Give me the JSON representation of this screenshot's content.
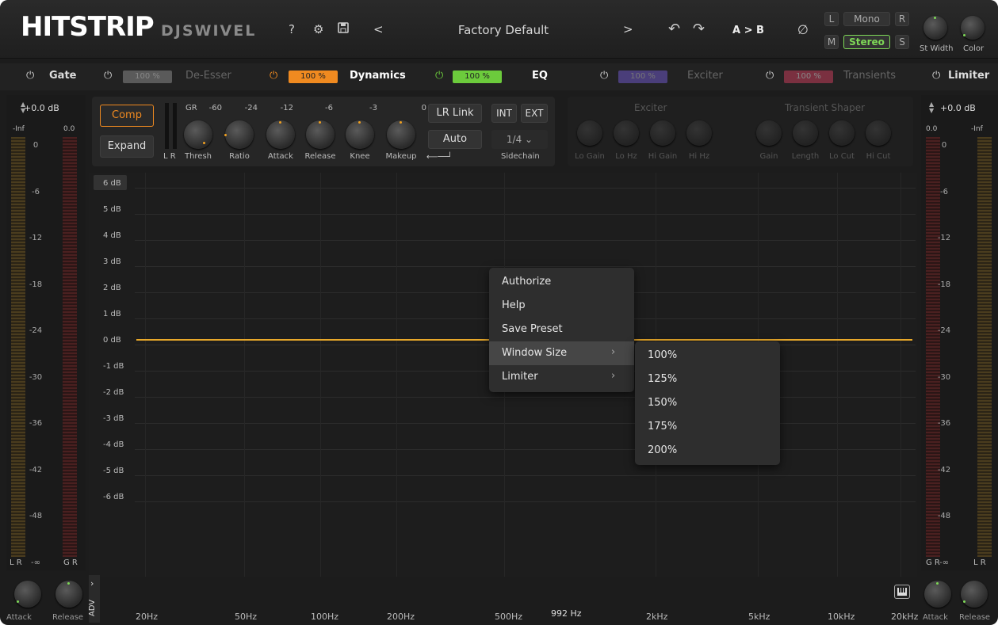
{
  "header": {
    "logo": "HITSTRIP",
    "brand": "DJSWIVEL",
    "help": "?",
    "gear": "⚙",
    "save": "🖫",
    "prev": "<",
    "preset": "Factory Default",
    "next": ">",
    "undo": "↶",
    "redo": "↷",
    "ab": "A > B",
    "bypass": "∅",
    "l": "L",
    "mono": "Mono",
    "r": "R",
    "m": "M",
    "stereo": "Stereo",
    "s": "S",
    "st_width": "St Width",
    "color": "Color"
  },
  "modules": {
    "gate": "Gate",
    "deesser": "De-Esser",
    "deesser_pct": "100 %",
    "dynamics": "Dynamics",
    "dynamics_pct": "100 %",
    "eq": "EQ",
    "eq_pct": "100 %",
    "exciter": "Exciter",
    "exciter_pct": "100 %",
    "transients": "Transients",
    "transients_pct": "100 %",
    "limiter": "Limiter"
  },
  "left_meter": {
    "value": "+0.0 dB",
    "top_left": "-Inf",
    "top_right": "0.0",
    "marks": [
      "0",
      "-6",
      "-12",
      "-18",
      "-24",
      "-30",
      "-36",
      "-42",
      "-48",
      "-∞"
    ],
    "foot_left": "L R",
    "foot_right": "G R",
    "attack": "Attack",
    "release": "Release"
  },
  "right_meter": {
    "value": "+0.0 dB",
    "top_left": "0.0",
    "top_right": "-Inf",
    "marks": [
      "0",
      "-6",
      "-12",
      "-18",
      "-24",
      "-30",
      "-36",
      "-42",
      "-48",
      "-∞"
    ],
    "foot_left": "G R",
    "foot_right": "L R",
    "attack": "Attack",
    "release": "Release"
  },
  "dynamics": {
    "comp": "Comp",
    "expand": "Expand",
    "gr": "GR",
    "gr_scale": [
      "-60",
      "-24",
      "-12",
      "-6",
      "-3",
      "0"
    ],
    "lr": "L R",
    "knobs": [
      "Thresh",
      "Ratio",
      "Attack",
      "Release",
      "Knee",
      "Makeup"
    ],
    "lr_link": "LR Link",
    "int": "INT",
    "ext": "EXT",
    "auto": "Auto",
    "sidechain_val": "1/4",
    "sidechain": "Sidechain"
  },
  "exciter": {
    "title": "Exciter",
    "knobs": [
      "Lo Gain",
      "Lo Hz",
      "Hi Gain",
      "Hi Hz"
    ]
  },
  "transient": {
    "title": "Transient Shaper",
    "knobs": [
      "Gain",
      "Length",
      "Lo Cut",
      "Hi Cut"
    ]
  },
  "graph": {
    "db_labels": [
      "6 dB",
      "5 dB",
      "4 dB",
      "3 dB",
      "2 dB",
      "1 dB",
      "0 dB",
      "-1 dB",
      "-2 dB",
      "-3 dB",
      "-4 dB",
      "-5 dB",
      "-6 dB"
    ],
    "freq_labels": [
      "20Hz",
      "50Hz",
      "100Hz",
      "200Hz",
      "500Hz",
      "2kHz",
      "5kHz",
      "10kHz",
      "20kHz"
    ],
    "cursor_freq": "992 Hz",
    "adv": "ADV",
    "line_color": "#e8a82a"
  },
  "menu": {
    "items": [
      "Authorize",
      "Help",
      "Save Preset",
      "Window Size",
      "Limiter"
    ],
    "submenu": [
      "100%",
      "125%",
      "150%",
      "175%",
      "200%"
    ]
  }
}
